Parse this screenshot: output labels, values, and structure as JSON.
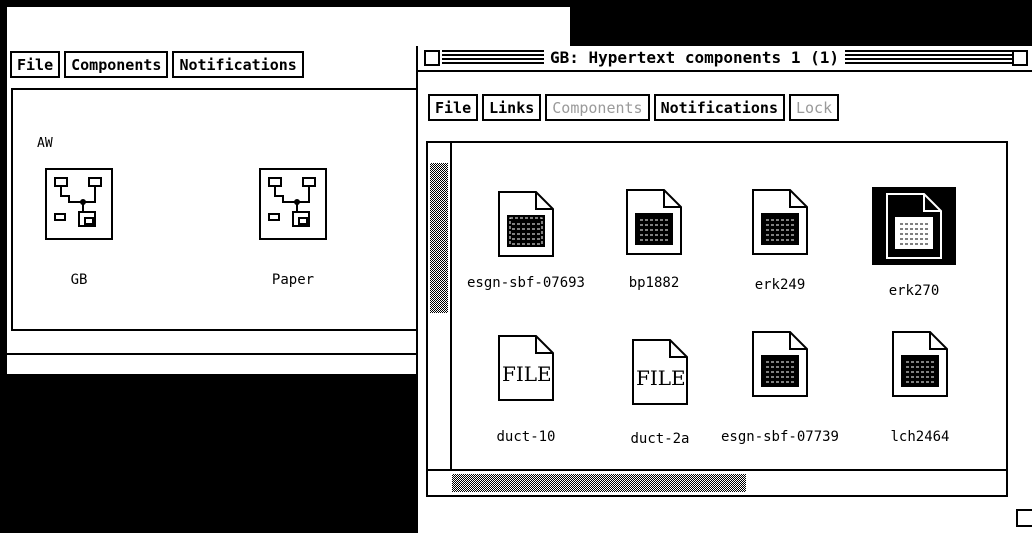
{
  "left_window": {
    "menu": [
      "File",
      "Components",
      "Notifications"
    ],
    "group_label": "AW",
    "icons": [
      {
        "label": "GB",
        "icon": "circuit-component-icon"
      },
      {
        "label": "Paper",
        "icon": "circuit-component-icon"
      }
    ]
  },
  "right_window": {
    "title": "GB: Hypertext components 1 (1)",
    "menu": [
      {
        "label": "File",
        "enabled": true
      },
      {
        "label": "Links",
        "enabled": true
      },
      {
        "label": "Components",
        "enabled": false
      },
      {
        "label": "Notifications",
        "enabled": true
      },
      {
        "label": "Lock",
        "enabled": false
      }
    ],
    "items": [
      {
        "label": "esgn-sbf-07693",
        "type": "document",
        "selected": false
      },
      {
        "label": "bp1882",
        "type": "document",
        "selected": false
      },
      {
        "label": "erk249",
        "type": "document",
        "selected": false
      },
      {
        "label": "erk270",
        "type": "document",
        "selected": true
      },
      {
        "label": "duct-10",
        "type": "file",
        "selected": false
      },
      {
        "label": "duct-2a",
        "type": "file",
        "selected": false
      },
      {
        "label": "esgn-sbf-07739",
        "type": "document",
        "selected": false
      },
      {
        "label": "lch2464",
        "type": "document",
        "selected": false
      }
    ],
    "file_icon_text": "FILE"
  }
}
